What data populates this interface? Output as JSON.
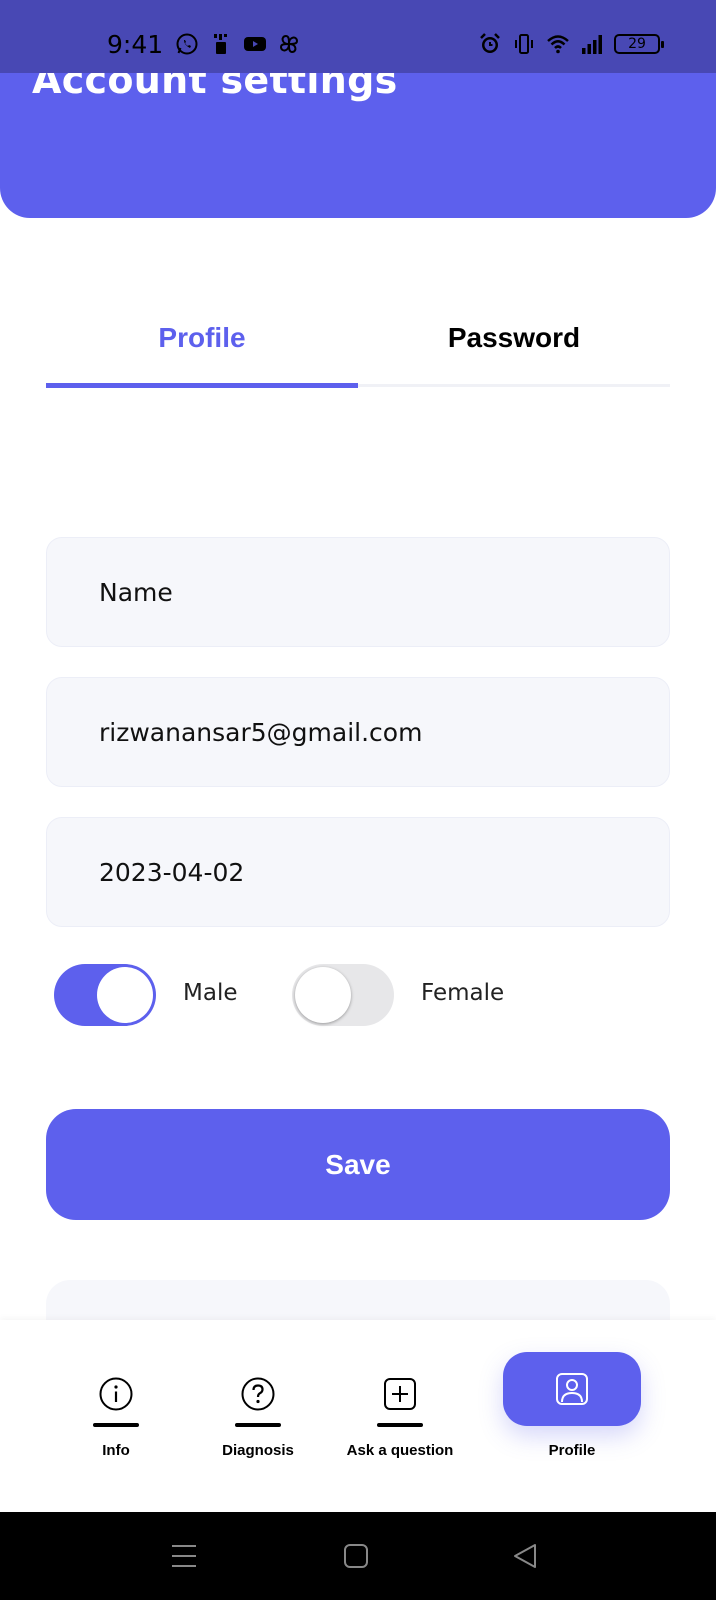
{
  "status_bar": {
    "time": "9:41",
    "left_icons": [
      "whatsapp-icon",
      "data-saver-icon",
      "youtube-icon",
      "pinwheel-icon"
    ],
    "right_icons": [
      "alarm-icon",
      "vibrate-icon",
      "wifi-icon",
      "signal-icon"
    ],
    "battery": "29"
  },
  "header": {
    "title": "Account settings"
  },
  "tabs": [
    {
      "label": "Profile",
      "active": true
    },
    {
      "label": "Password",
      "active": false
    }
  ],
  "form": {
    "name_placeholder": "Name",
    "email_value": "rizwanansar5@gmail.com",
    "dob_value": "2023-04-02",
    "gender": {
      "male_label": "Male",
      "female_label": "Female",
      "male_on": true,
      "female_on": false
    },
    "save_label": "Save"
  },
  "bottom_nav": {
    "items": [
      {
        "label": "Info",
        "icon": "info-icon"
      },
      {
        "label": "Diagnosis",
        "icon": "question-circle-icon"
      },
      {
        "label": "Ask a question",
        "icon": "plus-square-icon"
      },
      {
        "label": "Profile",
        "icon": "profile-card-icon",
        "active": true
      }
    ]
  },
  "colors": {
    "accent": "#5d60ed",
    "status_bar": "#4848b4",
    "field_bg": "#f6f7fb",
    "toggle_off": "#e7e7e9"
  }
}
